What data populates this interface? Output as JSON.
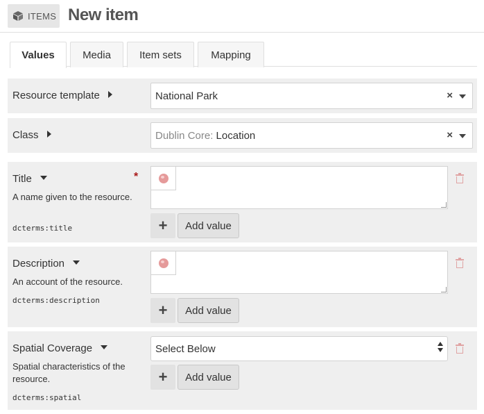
{
  "header": {
    "section_label": "ITEMS",
    "title": "New item"
  },
  "tabs": [
    {
      "label": "Values",
      "active": true
    },
    {
      "label": "Media",
      "active": false
    },
    {
      "label": "Item sets",
      "active": false
    },
    {
      "label": "Mapping",
      "active": false
    }
  ],
  "resource_template": {
    "label": "Resource template",
    "value": "National Park"
  },
  "class": {
    "label": "Class",
    "vocabulary": "Dublin Core:",
    "value": "Location"
  },
  "properties": [
    {
      "label": "Title",
      "description": "A name given to the resource.",
      "term": "dcterms:title",
      "required_mark": "*",
      "add_label": "Add value",
      "plus": "+"
    },
    {
      "label": "Description",
      "description": "An account of the resource.",
      "term": "dcterms:description",
      "add_label": "Add value",
      "plus": "+"
    },
    {
      "label": "Spatial Coverage",
      "description": "Spatial characteristics of the resource.",
      "term": "dcterms:spatial",
      "select_value": "Select Below",
      "add_label": "Add value",
      "plus": "+"
    }
  ],
  "clear_symbol": "×",
  "colors": {
    "required": "#a91919",
    "trash": "#e0a4a4",
    "globe": "#e59a9a"
  },
  "icons": {
    "section": "cube-icon",
    "language": "globe-icon",
    "remove": "trash-icon"
  }
}
